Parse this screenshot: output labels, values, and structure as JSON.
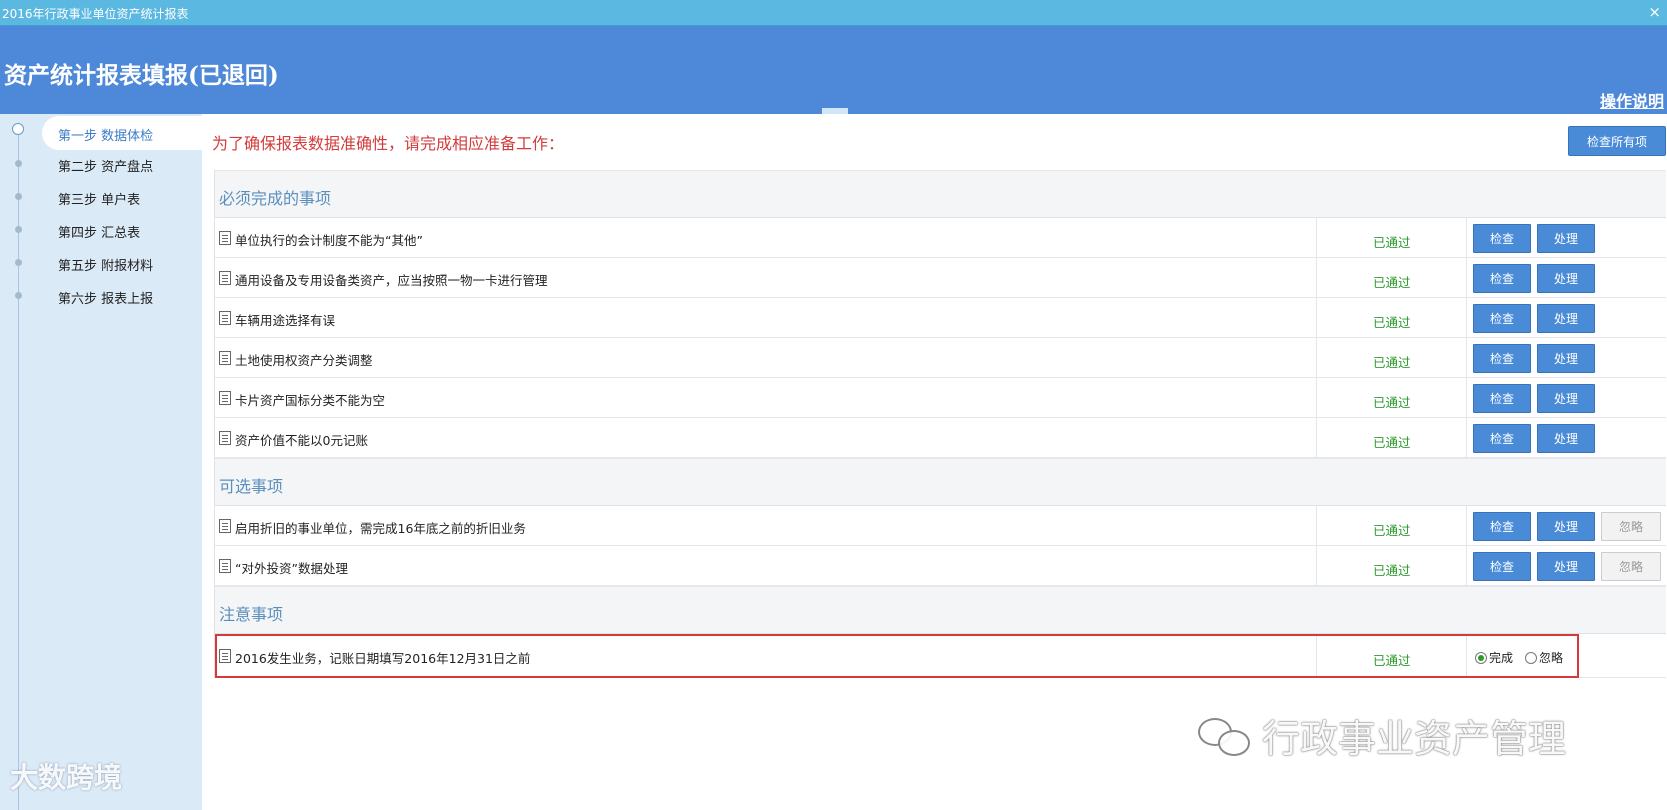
{
  "window": {
    "title": "2016年行政事业单位资产统计报表",
    "close_glyph": "×"
  },
  "header": {
    "title": "资产统计报表填报(已退回)",
    "help_link": "操作说明"
  },
  "steps": [
    {
      "label": "第一步 数据体检",
      "active": true
    },
    {
      "label": "第二步 资产盘点",
      "active": false
    },
    {
      "label": "第三步 单户表",
      "active": false
    },
    {
      "label": "第四步 汇总表",
      "active": false
    },
    {
      "label": "第五步 附报材料",
      "active": false
    },
    {
      "label": "第六步 报表上报",
      "active": false
    }
  ],
  "main": {
    "intro": "为了确保报表数据准确性，请完成相应准备工作：",
    "check_all": "检查所有项",
    "buttons": {
      "check": "检查",
      "handle": "处理",
      "ignore": "忽略"
    },
    "sections": [
      {
        "title": "必须完成的事项",
        "rows": [
          {
            "text": "单位执行的会计制度不能为“其他”",
            "status": "已通过"
          },
          {
            "text": "通用设备及专用设备类资产，应当按照一物一卡进行管理",
            "status": "已通过"
          },
          {
            "text": "车辆用途选择有误",
            "status": "已通过"
          },
          {
            "text": "土地使用权资产分类调整",
            "status": "已通过"
          },
          {
            "text": "卡片资产国标分类不能为空",
            "status": "已通过"
          },
          {
            "text": "资产价值不能以0元记账",
            "status": "已通过"
          }
        ]
      },
      {
        "title": "可选事项",
        "rows": [
          {
            "text": "启用折旧的事业单位，需完成16年底之前的折旧业务",
            "status": "已通过"
          },
          {
            "text": "“对外投资”数据处理",
            "status": "已通过"
          }
        ]
      },
      {
        "title": "注意事项",
        "rows": [
          {
            "text": "2016发生业务，记账日期填写2016年12月31日之前",
            "status": "已通过",
            "radio_done": "完成",
            "radio_ignore": "忽略"
          }
        ]
      }
    ]
  },
  "watermarks": {
    "left": "大数跨境",
    "right": "行政事业资产管理"
  },
  "colors": {
    "header": "#4d88d9",
    "titlebar": "#5bb8e0",
    "button": "#4a8bd8",
    "status_pass": "#2b9a2b",
    "intro": "#d23c3c",
    "highlight": "#d43a3a"
  }
}
